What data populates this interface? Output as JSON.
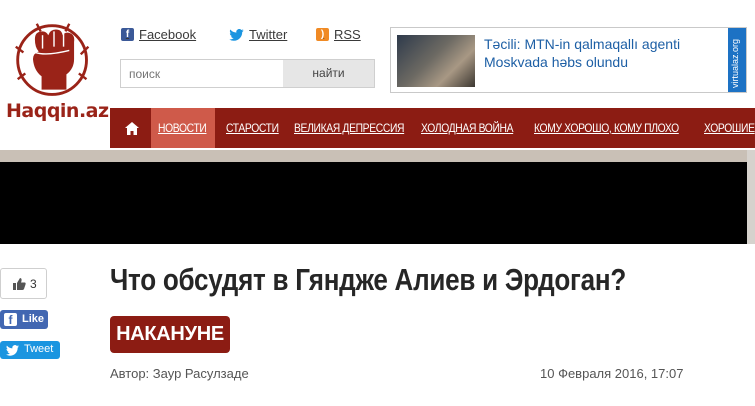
{
  "logo": {
    "text": "Haqqin.az"
  },
  "social": {
    "facebook": "Facebook",
    "twitter": "Twitter",
    "rss": "RSS"
  },
  "search": {
    "placeholder": "поиск",
    "button": "найти"
  },
  "ad": {
    "headline": "Təcili: MTN-in qalmaqallı agenti Moskvada həbs olundu",
    "side_label": "virtualaz.org"
  },
  "nav": {
    "items": [
      {
        "label": "НОВОСТИ",
        "active": true
      },
      {
        "label": "СТАРОСТИ"
      },
      {
        "label": "ВЕЛИКАЯ ДЕПРЕССИЯ"
      },
      {
        "label": "ХОЛОДНАЯ ВОЙНА"
      },
      {
        "label": "КОМУ ХОРОШО, КОМУ ПЛОХО"
      },
      {
        "label": "ХОРОШИЕ"
      }
    ]
  },
  "share": {
    "like_count": "3",
    "fb_like": "Like",
    "tweet": "Tweet"
  },
  "article": {
    "title": "Что обсудят в Гяндже Алиев и Эрдоган?",
    "category": "НАКАНУНЕ",
    "author": "Автор: Заур Расулзаде",
    "date": "10 Февраля 2016, 17:07"
  },
  "colors": {
    "brand": "#8c1c13",
    "nav_active": "#cf5a4a",
    "facebook": "#4267b2",
    "twitter": "#1b95e0",
    "link": "#1d5fa5"
  },
  "icons": [
    "fist-logo-icon",
    "facebook-icon",
    "twitter-bird-icon",
    "rss-icon",
    "home-icon",
    "thumbs-up-icon"
  ]
}
